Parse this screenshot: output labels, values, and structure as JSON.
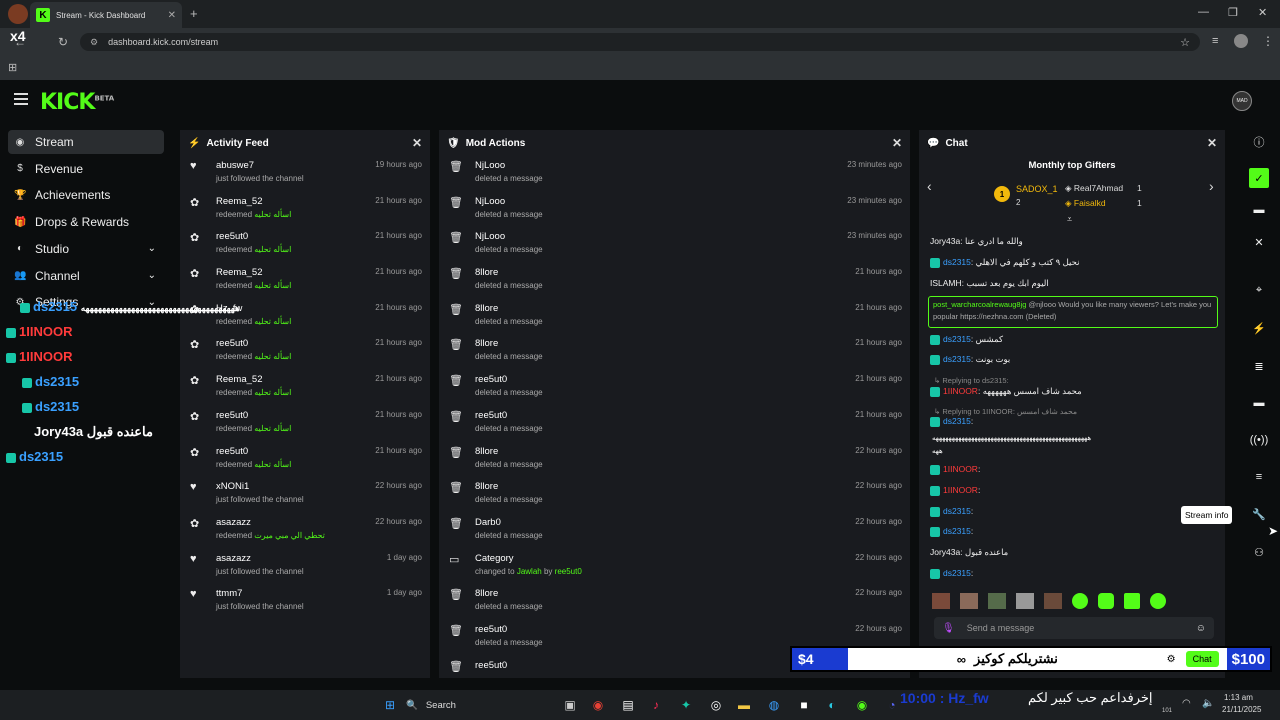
{
  "browser": {
    "tab_title": "Stream - Kick Dashboard",
    "url": "dashboard.kick.com/stream"
  },
  "kick": {
    "logo": "KICK",
    "logo_tag": "BETA",
    "avatar_label": "MAD"
  },
  "sidebar": {
    "items": [
      {
        "label": "Stream",
        "icon": "broadcast-icon"
      },
      {
        "label": "Revenue",
        "icon": "dollar-icon"
      },
      {
        "label": "Achievements",
        "icon": "trophy-icon"
      },
      {
        "label": "Drops & Rewards",
        "icon": "gift-icon"
      },
      {
        "label": "Studio",
        "icon": "palette-icon"
      },
      {
        "label": "Channel",
        "icon": "users-icon"
      },
      {
        "label": "Settings",
        "icon": "gear-icon"
      }
    ]
  },
  "activity": {
    "title": "Activity Feed",
    "items": [
      {
        "name": "abuswe7",
        "action": "just followed the channel",
        "reward": "",
        "time": "19 hours ago",
        "type": "follow"
      },
      {
        "name": "Reema_52",
        "action": "redeemed",
        "reward": "اسأله تحليه",
        "time": "21 hours ago",
        "type": "redeem"
      },
      {
        "name": "ree5ut0",
        "action": "redeemed",
        "reward": "اسأله تحليه",
        "time": "21 hours ago",
        "type": "redeem"
      },
      {
        "name": "Reema_52",
        "action": "redeemed",
        "reward": "اسأله تحليه",
        "time": "21 hours ago",
        "type": "redeem"
      },
      {
        "name": "Hz_fw",
        "action": "redeemed",
        "reward": "اسأله تحليه",
        "time": "21 hours ago",
        "type": "redeem"
      },
      {
        "name": "ree5ut0",
        "action": "redeemed",
        "reward": "اسأله تحليه",
        "time": "21 hours ago",
        "type": "redeem"
      },
      {
        "name": "Reema_52",
        "action": "redeemed",
        "reward": "اسأله تحليه",
        "time": "21 hours ago",
        "type": "redeem"
      },
      {
        "name": "ree5ut0",
        "action": "redeemed",
        "reward": "اسأله تحليه",
        "time": "21 hours ago",
        "type": "redeem"
      },
      {
        "name": "ree5ut0",
        "action": "redeemed",
        "reward": "اسأله تحليه",
        "time": "21 hours ago",
        "type": "redeem"
      },
      {
        "name": "xNONi1",
        "action": "just followed the channel",
        "reward": "",
        "time": "22 hours ago",
        "type": "follow"
      },
      {
        "name": "asazazz",
        "action": "redeemed",
        "reward": "تحطي الي مبي ميرت",
        "time": "22 hours ago",
        "type": "redeem"
      },
      {
        "name": "asazazz",
        "action": "just followed the channel",
        "reward": "",
        "time": "1 day ago",
        "type": "follow"
      },
      {
        "name": "ttmm7",
        "action": "just followed the channel",
        "reward": "",
        "time": "1 day ago",
        "type": "follow"
      }
    ]
  },
  "mod": {
    "title": "Mod Actions",
    "items": [
      {
        "name": "NjLooo",
        "action": "deleted a message",
        "time": "23 minutes ago"
      },
      {
        "name": "NjLooo",
        "action": "deleted a message",
        "time": "23 minutes ago"
      },
      {
        "name": "NjLooo",
        "action": "deleted a message",
        "time": "23 minutes ago"
      },
      {
        "name": "8llore",
        "action": "deleted a message",
        "time": "21 hours ago"
      },
      {
        "name": "8llore",
        "action": "deleted a message",
        "time": "21 hours ago"
      },
      {
        "name": "8llore",
        "action": "deleted a message",
        "time": "21 hours ago"
      },
      {
        "name": "ree5ut0",
        "action": "deleted a message",
        "time": "21 hours ago"
      },
      {
        "name": "ree5ut0",
        "action": "deleted a message",
        "time": "21 hours ago"
      },
      {
        "name": "8llore",
        "action": "deleted a message",
        "time": "22 hours ago"
      },
      {
        "name": "8llore",
        "action": "deleted a message",
        "time": "22 hours ago"
      },
      {
        "name": "Darb0",
        "action": "deleted a message",
        "time": "22 hours ago"
      },
      {
        "name": "Category",
        "action": "changed to",
        "highlight": "Jawlah",
        "by": "by",
        "byname": "ree5ut0",
        "time": "22 hours ago"
      },
      {
        "name": "8llore",
        "action": "deleted a message",
        "time": "22 hours ago"
      },
      {
        "name": "ree5ut0",
        "action": "deleted a message",
        "time": "22 hours ago"
      },
      {
        "name": "ree5ut0",
        "action": "",
        "time": ""
      }
    ]
  },
  "chat": {
    "title": "Chat",
    "gifters_title": "Monthly top Gifters",
    "first": {
      "rank": "1",
      "name": "SADOX_1",
      "count": "2"
    },
    "others": [
      {
        "name": "Real7Ahmad",
        "count": "1"
      },
      {
        "name": "Faisalkd",
        "count": "1"
      }
    ],
    "messages": [
      {
        "user": "Jory43a",
        "text": "والله ما ادري عنا",
        "color": "w"
      },
      {
        "user": "ds2315",
        "text": "نحيل ٩ كتب و كلهم في الاهلي",
        "color": "u"
      },
      {
        "user": "ISLAMH",
        "text": "اليوم ابك يوم بعد تسبب",
        "color": "w"
      },
      {
        "user": "ds2315",
        "text": "كمشس",
        "color": "u"
      },
      {
        "user": "ds2315",
        "text": "بوت بونت",
        "color": "u"
      },
      {
        "user": "1IINOOR",
        "text": "محمد شاف امسس ههههههه",
        "color": "r"
      },
      {
        "user": "ds2315",
        "text": "",
        "color": "u"
      },
      {
        "user": "1IINOOR",
        "text": "",
        "color": "r"
      },
      {
        "user": "1IINOOR",
        "text": "",
        "color": "r"
      },
      {
        "user": "ds2315",
        "text": "",
        "color": "u"
      },
      {
        "user": "ds2315",
        "text": "",
        "color": "u"
      },
      {
        "user": "Jory43a",
        "text": "ماعنده قبول",
        "color": "w"
      },
      {
        "user": "ds2315",
        "text": "",
        "color": "u"
      }
    ],
    "deleted_user": "post_warcharcoalrewaug8jg",
    "deleted_text": "@njlooo Would you like many viewers? Let's make you popular",
    "deleted_link": "https://nezhna.com (Deleted)",
    "replying_1": "Replying to ds2315:",
    "replying_2": "Replying to 1IINOOR:",
    "reply_preview": "محمد شاف امسس",
    "long_text": "ههههههههههههههههههههههههههههههههههههههههههههههههه",
    "long_text_2": "ههه",
    "input_placeholder": "Send a message"
  },
  "tooltip": "Stream info",
  "overlay": {
    "lines": [
      {
        "user": "ds2315",
        "text": "هههههههههههههههههههههههههههههههههههههه"
      },
      {
        "user": "1IINOOR",
        "text": ""
      },
      {
        "user": "1IINOOR",
        "text": ""
      },
      {
        "user": "ds2315",
        "text": ""
      },
      {
        "user": "ds2315",
        "text": ""
      },
      {
        "user": "Jory43a",
        "text": "ماعنده قبول"
      },
      {
        "user": "ds2315",
        "text": ""
      }
    ],
    "count_label": "x4"
  },
  "donation": {
    "left": "$4",
    "text": "نشتريلكم كوكيز",
    "infinity": "∞",
    "chat_btn": "Chat",
    "right": "$100"
  },
  "taskbar": {
    "search": "Search",
    "ticker": "إخرفداعم حب كبير لكم",
    "ticker2": "10:00 : Hz_fw",
    "time": "1:13 am",
    "date": "21/11/2025",
    "speaker": "101"
  },
  "colors": {
    "kick_green": "#53fc18",
    "panel_bg": "#191b1f",
    "page_bg": "#0b0d0e"
  }
}
